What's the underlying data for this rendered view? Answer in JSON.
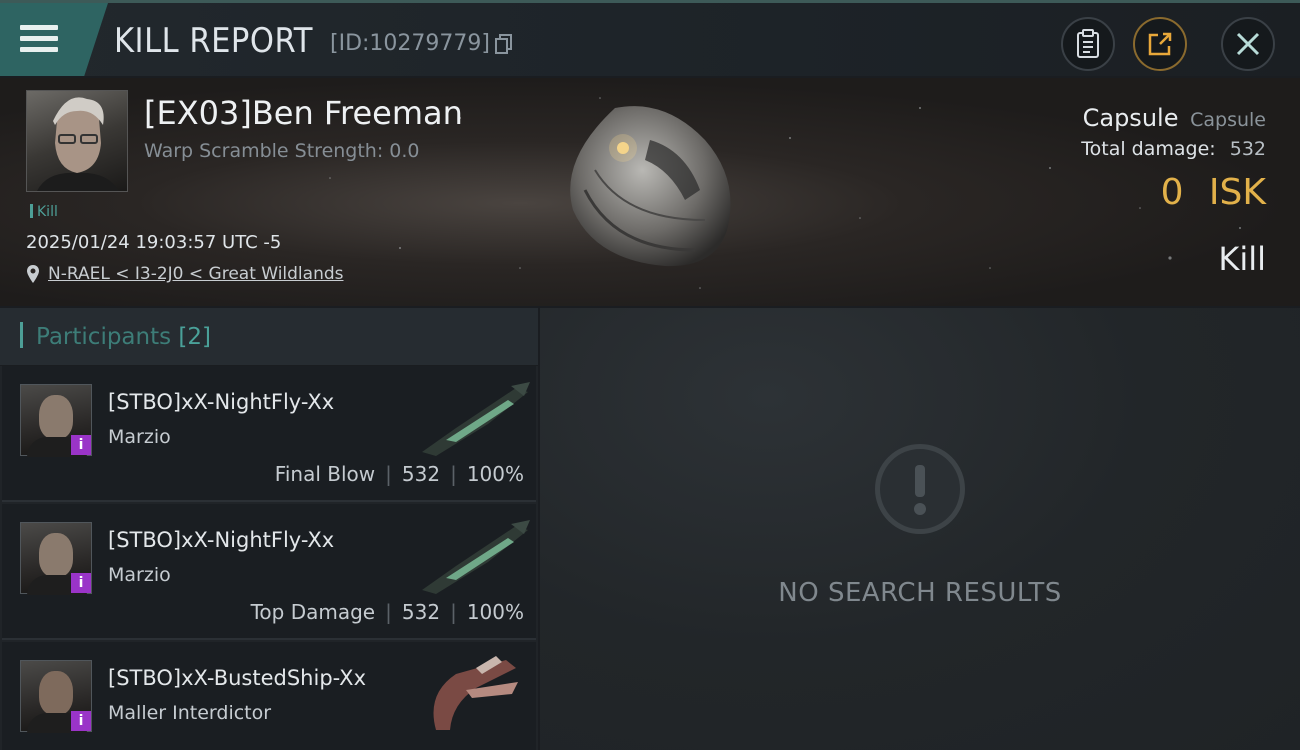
{
  "header": {
    "title": "KILL REPORT",
    "id_label": "[ID:10279779]"
  },
  "victim": {
    "name": "[EX03]Ben Freeman",
    "warp_scramble": "Warp Scramble Strength: 0.0",
    "kill_tag": "Kill",
    "datetime": "2025/01/24 19:03:57 UTC -5",
    "location": "N-RAEL < I3-2J0 < Great Wildlands",
    "ship_type": "Capsule",
    "ship_class": "Capsule",
    "total_damage_label": "Total damage:",
    "total_damage_value": "532",
    "isk_value": "0",
    "isk_unit": "ISK",
    "outcome": "Kill"
  },
  "participants": {
    "label": "Participants",
    "count": "[2]",
    "rows": [
      {
        "name": "[STBO]xX-NightFly-Xx",
        "ship": "Marzio",
        "role": "Final Blow",
        "damage": "532",
        "percent": "100%"
      },
      {
        "name": "[STBO]xX-NightFly-Xx",
        "ship": "Marzio",
        "role": "Top Damage",
        "damage": "532",
        "percent": "100%"
      },
      {
        "name": "[STBO]xX-BustedShip-Xx",
        "ship": "Maller Interdictor"
      }
    ]
  },
  "results": {
    "empty_text": "NO SEARCH RESULTS"
  },
  "colors": {
    "accent_teal": "#4d9f97",
    "isk_gold": "#e2b14a",
    "badge_purple": "#9a34c8"
  },
  "icons": [
    "menu-icon",
    "copy-icon",
    "clipboard-icon",
    "share-icon",
    "close-icon",
    "location-pin-icon",
    "warning-icon"
  ]
}
